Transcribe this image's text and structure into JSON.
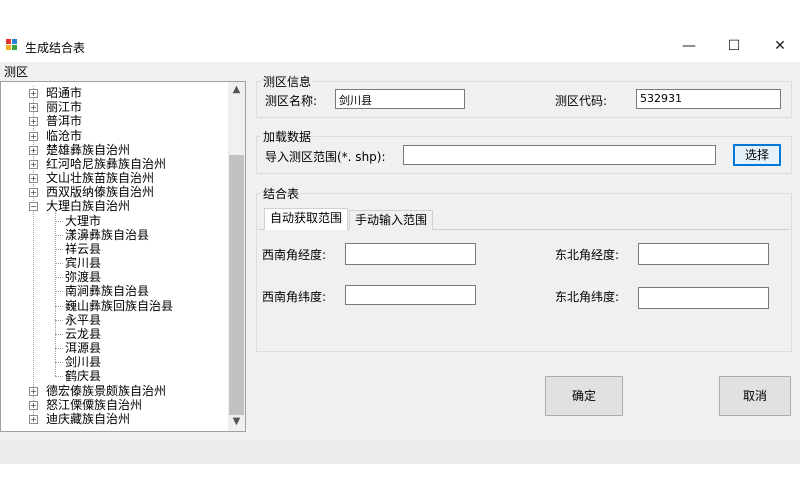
{
  "window": {
    "title": "生成结合表",
    "minimize_glyph": "—",
    "maximize_glyph": "☐",
    "close_glyph": "✕"
  },
  "tree": {
    "caption": "测区",
    "top_items": [
      {
        "label": "昭通市",
        "expander": "+"
      },
      {
        "label": "丽江市",
        "expander": "+"
      },
      {
        "label": "普洱市",
        "expander": "+"
      },
      {
        "label": "临沧市",
        "expander": "+"
      },
      {
        "label": "楚雄彝族自治州",
        "expander": "+"
      },
      {
        "label": "红河哈尼族彝族自治州",
        "expander": "+"
      },
      {
        "label": "文山壮族苗族自治州",
        "expander": "+"
      },
      {
        "label": "西双版纳傣族自治州",
        "expander": "+"
      },
      {
        "label": "大理白族自治州",
        "expander": "−"
      }
    ],
    "children": [
      "大理市",
      "漾濞彝族自治县",
      "祥云县",
      "宾川县",
      "弥渡县",
      "南涧彝族自治县",
      "巍山彝族回族自治县",
      "永平县",
      "云龙县",
      "洱源县",
      "剑川县",
      "鹤庆县"
    ],
    "bottom_items": [
      {
        "label": "德宏傣族景颇族自治州",
        "expander": "+"
      },
      {
        "label": "怒江傈僳族自治州",
        "expander": "+"
      },
      {
        "label": "迪庆藏族自治州",
        "expander": "+"
      }
    ],
    "scroll_up": "▲",
    "scroll_down": "▼"
  },
  "survey_info": {
    "group_title": "测区信息",
    "name_label": "测区名称:",
    "name_value": "剑川县",
    "code_label": "测区代码:",
    "code_value": "532931"
  },
  "load_data": {
    "group_title": "加载数据",
    "import_label": "导入测区范围(*. shp):",
    "import_value": "",
    "select_button": "选择"
  },
  "join_table": {
    "group_title": "结合表",
    "tabs": [
      "自动获取范围",
      "手动输入范围"
    ],
    "sw_lon_label": "西南角经度:",
    "ne_lon_label": "东北角经度:",
    "sw_lat_label": "西南角纬度:",
    "ne_lat_label": "东北角纬度:",
    "sw_lon_value": "",
    "ne_lon_value": "",
    "sw_lat_value": "",
    "ne_lat_value": ""
  },
  "actions": {
    "ok": "确定",
    "cancel": "取消"
  },
  "colors": {
    "accent": "#0078d7",
    "client_bg": "#f0f0f0"
  }
}
